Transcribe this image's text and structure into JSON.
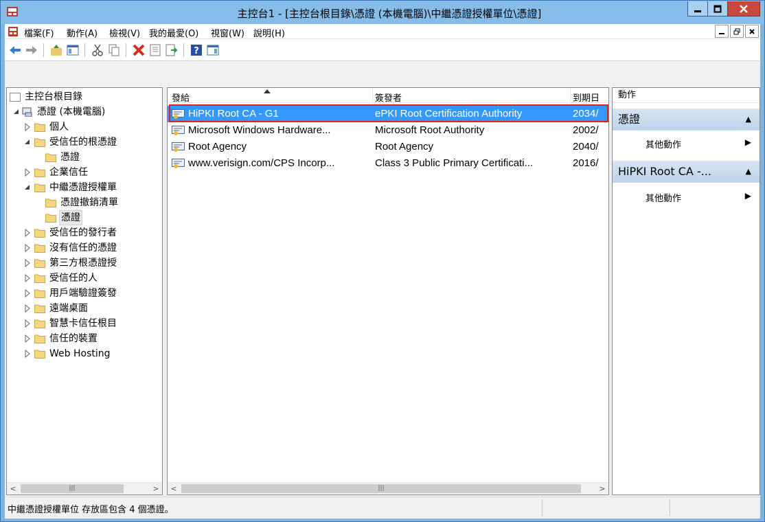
{
  "window": {
    "title": "主控台1 - [主控台根目錄\\憑證 (本機電腦)\\中繼憑證授權單位\\憑證]"
  },
  "menubar": {
    "items": [
      "檔案(F)",
      "動作(A)",
      "檢視(V)",
      "我的最愛(O)",
      "視窗(W)",
      "說明(H)"
    ]
  },
  "tree": {
    "root": "主控台根目錄",
    "store": "憑證 (本機電腦)",
    "nodes": [
      {
        "label": "個人"
      },
      {
        "label": "受信任的根憑證"
      },
      {
        "label": "憑證"
      },
      {
        "label": "企業信任"
      },
      {
        "label": "中繼憑證授權單"
      },
      {
        "label": "憑證撤銷清單"
      },
      {
        "label": "憑證"
      },
      {
        "label": "受信任的發行者"
      },
      {
        "label": "沒有信任的憑證"
      },
      {
        "label": "第三方根憑證授"
      },
      {
        "label": "受信任的人"
      },
      {
        "label": "用戶端驗證簽發"
      },
      {
        "label": "遠端桌面"
      },
      {
        "label": "智慧卡信任根目"
      },
      {
        "label": "信任的裝置"
      },
      {
        "label": "Web Hosting"
      }
    ]
  },
  "list": {
    "columns": [
      "發給",
      "簽發者",
      "到期日"
    ],
    "rows": [
      {
        "issued_to": "HiPKI Root CA - G1",
        "issued_by": "ePKI Root Certification Authority",
        "expiry": "2034/",
        "selected": true
      },
      {
        "issued_to": "Microsoft Windows Hardware...",
        "issued_by": "Microsoft Root Authority",
        "expiry": "2002/",
        "selected": false
      },
      {
        "issued_to": "Root Agency",
        "issued_by": "Root Agency",
        "expiry": "2040/",
        "selected": false
      },
      {
        "issued_to": "www.verisign.com/CPS Incorp...",
        "issued_by": "Class 3 Public Primary Certificati...",
        "expiry": "2016/",
        "selected": false
      }
    ]
  },
  "actions": {
    "header": "動作",
    "sections": [
      {
        "title": "憑證",
        "item": "其他動作"
      },
      {
        "title": "HiPKI Root CA -...",
        "item": "其他動作"
      }
    ]
  },
  "status": {
    "text": "中繼憑證授權單位 存放區包含 4 個憑證。"
  },
  "colors": {
    "titlebar": "#86bce8",
    "selection": "#3399ff",
    "highlight_box": "#e0201c",
    "close_button": "#c9483e"
  }
}
